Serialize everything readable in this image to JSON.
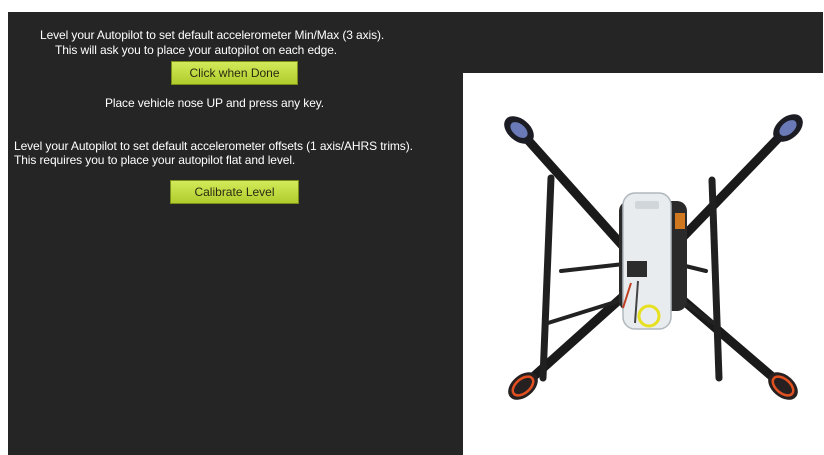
{
  "calibration": {
    "accel_intro_line1": "Level your Autopilot to set default accelerometer Min/Max (3 axis).",
    "accel_intro_line2": "This will ask you to place your autopilot on each edge.",
    "click_when_done_label": "Click when Done",
    "status_message": "Place vehicle nose UP and press any key.",
    "level_intro_line1": "Level your Autopilot to set default accelerometer offsets (1 axis/AHRS trims).",
    "level_intro_line2": "This requires you to place your autopilot flat and level.",
    "calibrate_level_label": "Calibrate Level"
  },
  "colors": {
    "panel_background": "#252525",
    "button_green": "#c2dc40",
    "text": "#ffffff"
  },
  "photo": {
    "subject": "quadcopter-drone"
  }
}
